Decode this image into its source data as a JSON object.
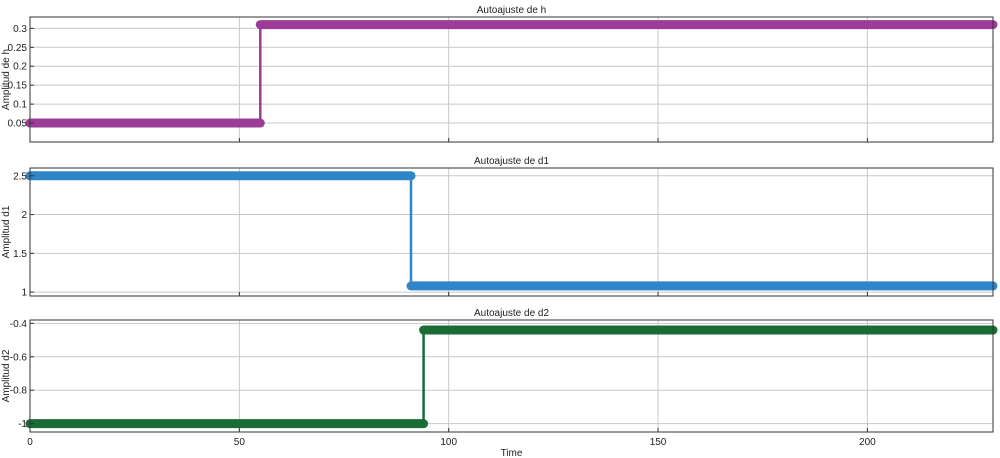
{
  "chart_data": [
    {
      "type": "line",
      "title": "Autoajuste de h",
      "xlabel": "",
      "ylabel": "Amplitud de h",
      "xlim": [
        0,
        230
      ],
      "ylim": [
        0.0,
        0.33
      ],
      "yticks": [
        0.05,
        0.1,
        0.15,
        0.2,
        0.25,
        0.3
      ],
      "ytick_labels": [
        "0.05",
        "0.1",
        "0.15",
        "0.2",
        "0.25",
        "0.3"
      ],
      "xticks": [
        0,
        50,
        100,
        150,
        200
      ],
      "show_xtick_labels": false,
      "grid": true,
      "series": [
        {
          "color": "#9b3d96",
          "x": [
            0,
            55,
            55,
            230
          ],
          "y": [
            0.05,
            0.05,
            0.31,
            0.31
          ]
        }
      ]
    },
    {
      "type": "line",
      "title": "Autoajuste de d1",
      "xlabel": "",
      "ylabel": "Amplitud d1",
      "xlim": [
        0,
        230
      ],
      "ylim": [
        0.95,
        2.6
      ],
      "yticks": [
        1,
        1.5,
        2,
        2.5
      ],
      "ytick_labels": [
        "1",
        "1.5",
        "2",
        "2.5"
      ],
      "xticks": [
        0,
        50,
        100,
        150,
        200
      ],
      "show_xtick_labels": false,
      "grid": true,
      "series": [
        {
          "color": "#2e86c8",
          "x": [
            0,
            91,
            91,
            230
          ],
          "y": [
            2.5,
            2.5,
            1.08,
            1.08
          ]
        }
      ]
    },
    {
      "type": "line",
      "title": "Autoajuste de d2",
      "xlabel": "Time",
      "ylabel": "Amplitud d2",
      "xlim": [
        0,
        230
      ],
      "ylim": [
        -1.05,
        -0.38
      ],
      "yticks": [
        -1,
        -0.8,
        -0.6,
        -0.4
      ],
      "ytick_labels": [
        "-1",
        "-0.8",
        "-0.6",
        "-0.4"
      ],
      "xticks": [
        0,
        50,
        100,
        150,
        200
      ],
      "xtick_labels": [
        "0",
        "50",
        "100",
        "150",
        "200"
      ],
      "show_xtick_labels": true,
      "grid": true,
      "series": [
        {
          "color": "#1a6b35",
          "x": [
            0,
            94,
            94,
            230
          ],
          "y": [
            -1.0,
            -1.0,
            -0.44,
            -0.44
          ]
        }
      ]
    }
  ]
}
